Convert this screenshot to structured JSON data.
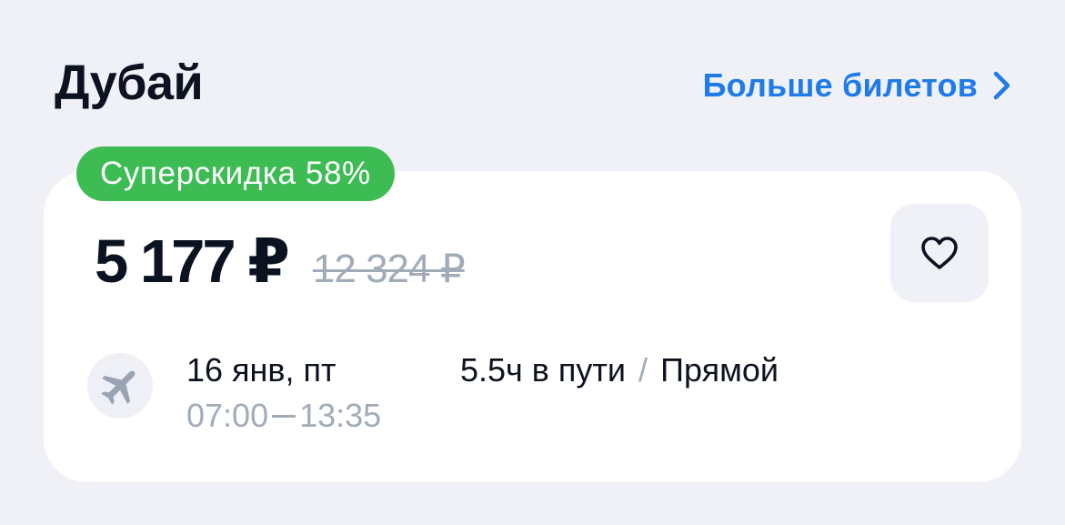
{
  "header": {
    "title": "Дубай",
    "more_link_label": "Больше билетов"
  },
  "offer": {
    "badge": "Суперскидка 58%",
    "price": "5 177 ₽",
    "old_price": "12 324 ₽",
    "date": "16 янв, пт",
    "departure_time": "07:00",
    "arrival_time": "13:35",
    "duration": "5.5ч в пути",
    "separator": "/",
    "stops": "Прямой"
  },
  "colors": {
    "accent": "#1e7be8",
    "badge_bg": "#3dbc54",
    "muted": "#a2abb8",
    "page_bg": "#eff1f6"
  },
  "icons": {
    "more": "chevron-right-icon",
    "favorite": "heart-icon",
    "flight": "plane-icon"
  }
}
